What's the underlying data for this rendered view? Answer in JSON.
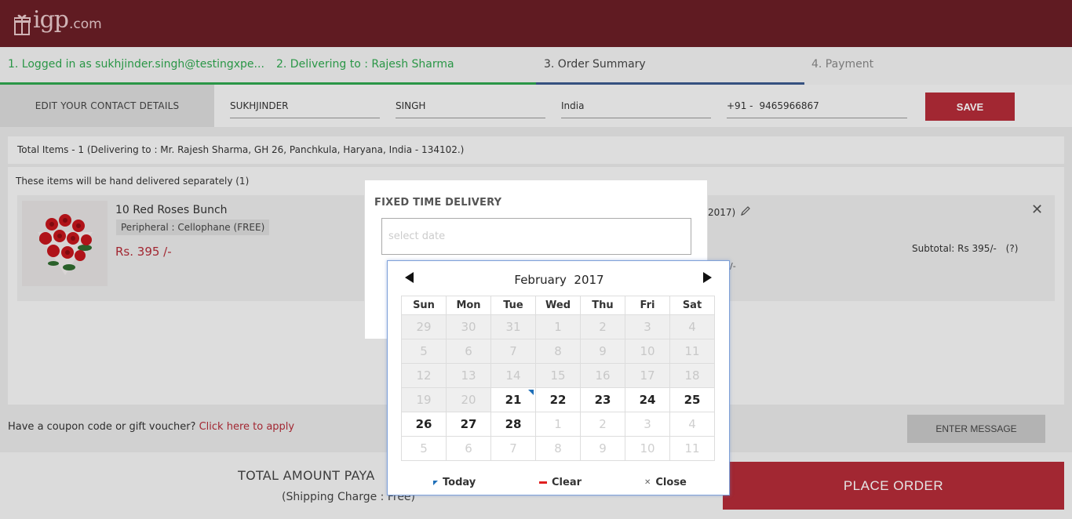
{
  "header": {
    "brand": "igp",
    "tld": ".com"
  },
  "steps": [
    {
      "label": "1. Logged in as sukhjinder.singh@testingxpe..."
    },
    {
      "label": "2. Delivering to : Rajesh Sharma"
    },
    {
      "label": "3. Order Summary"
    },
    {
      "label": "4. Payment"
    }
  ],
  "contact": {
    "edit_label": "EDIT YOUR CONTACT DETAILS",
    "first_name": "SUKHJINDER",
    "last_name": "SINGH",
    "country": "India",
    "phone_code": "+91 -",
    "phone": "9465966867",
    "save_label": "SAVE"
  },
  "totals_text": "Total Items - 1 (Delivering to : Mr. Rajesh Sharma, GH 26, Panchkula, Haryana, India - 134102.)",
  "items_section": {
    "heading": "These items will be hand delivered separately (1)",
    "item": {
      "name": "10 Red Roses Bunch",
      "tag": "Peripheral : Cellophane (FREE)",
      "price": "Rs. 395 /-",
      "date_partial": "2017)",
      "subtotal": "Subtotal: Rs 395/-",
      "help": "(?)",
      "slash": "/-"
    }
  },
  "coupon": {
    "text": "Have a coupon code or gift voucher?",
    "link": "Click here to apply"
  },
  "enter_message": "ENTER MESSAGE",
  "footer": {
    "total_label": "TOTAL AMOUNT PAYA",
    "shipping": "(Shipping Charge : Free)",
    "place_order": "PLACE ORDER"
  },
  "modal": {
    "title": "FIXED TIME DELIVERY",
    "placeholder": "select date"
  },
  "calendar": {
    "month": "February",
    "year": "2017",
    "weekdays": [
      "Sun",
      "Mon",
      "Tue",
      "Wed",
      "Thu",
      "Fri",
      "Sat"
    ],
    "weeks": [
      [
        "29",
        "30",
        "31",
        "1",
        "2",
        "3",
        "4"
      ],
      [
        "5",
        "6",
        "7",
        "8",
        "9",
        "10",
        "11"
      ],
      [
        "12",
        "13",
        "14",
        "15",
        "16",
        "17",
        "18"
      ],
      [
        "19",
        "20",
        "21",
        "22",
        "23",
        "24",
        "25"
      ],
      [
        "26",
        "27",
        "28",
        "1",
        "2",
        "3",
        "4"
      ],
      [
        "5",
        "6",
        "7",
        "8",
        "9",
        "10",
        "11"
      ]
    ],
    "today_label": "Today",
    "clear_label": "Clear",
    "close_label": "Close"
  },
  "colors": {
    "header": "#6b1f26",
    "accent": "#b52c38",
    "done": "#2fa84f",
    "current_bar": "#3b5b8f",
    "calendar_border": "#7fa1d9"
  }
}
